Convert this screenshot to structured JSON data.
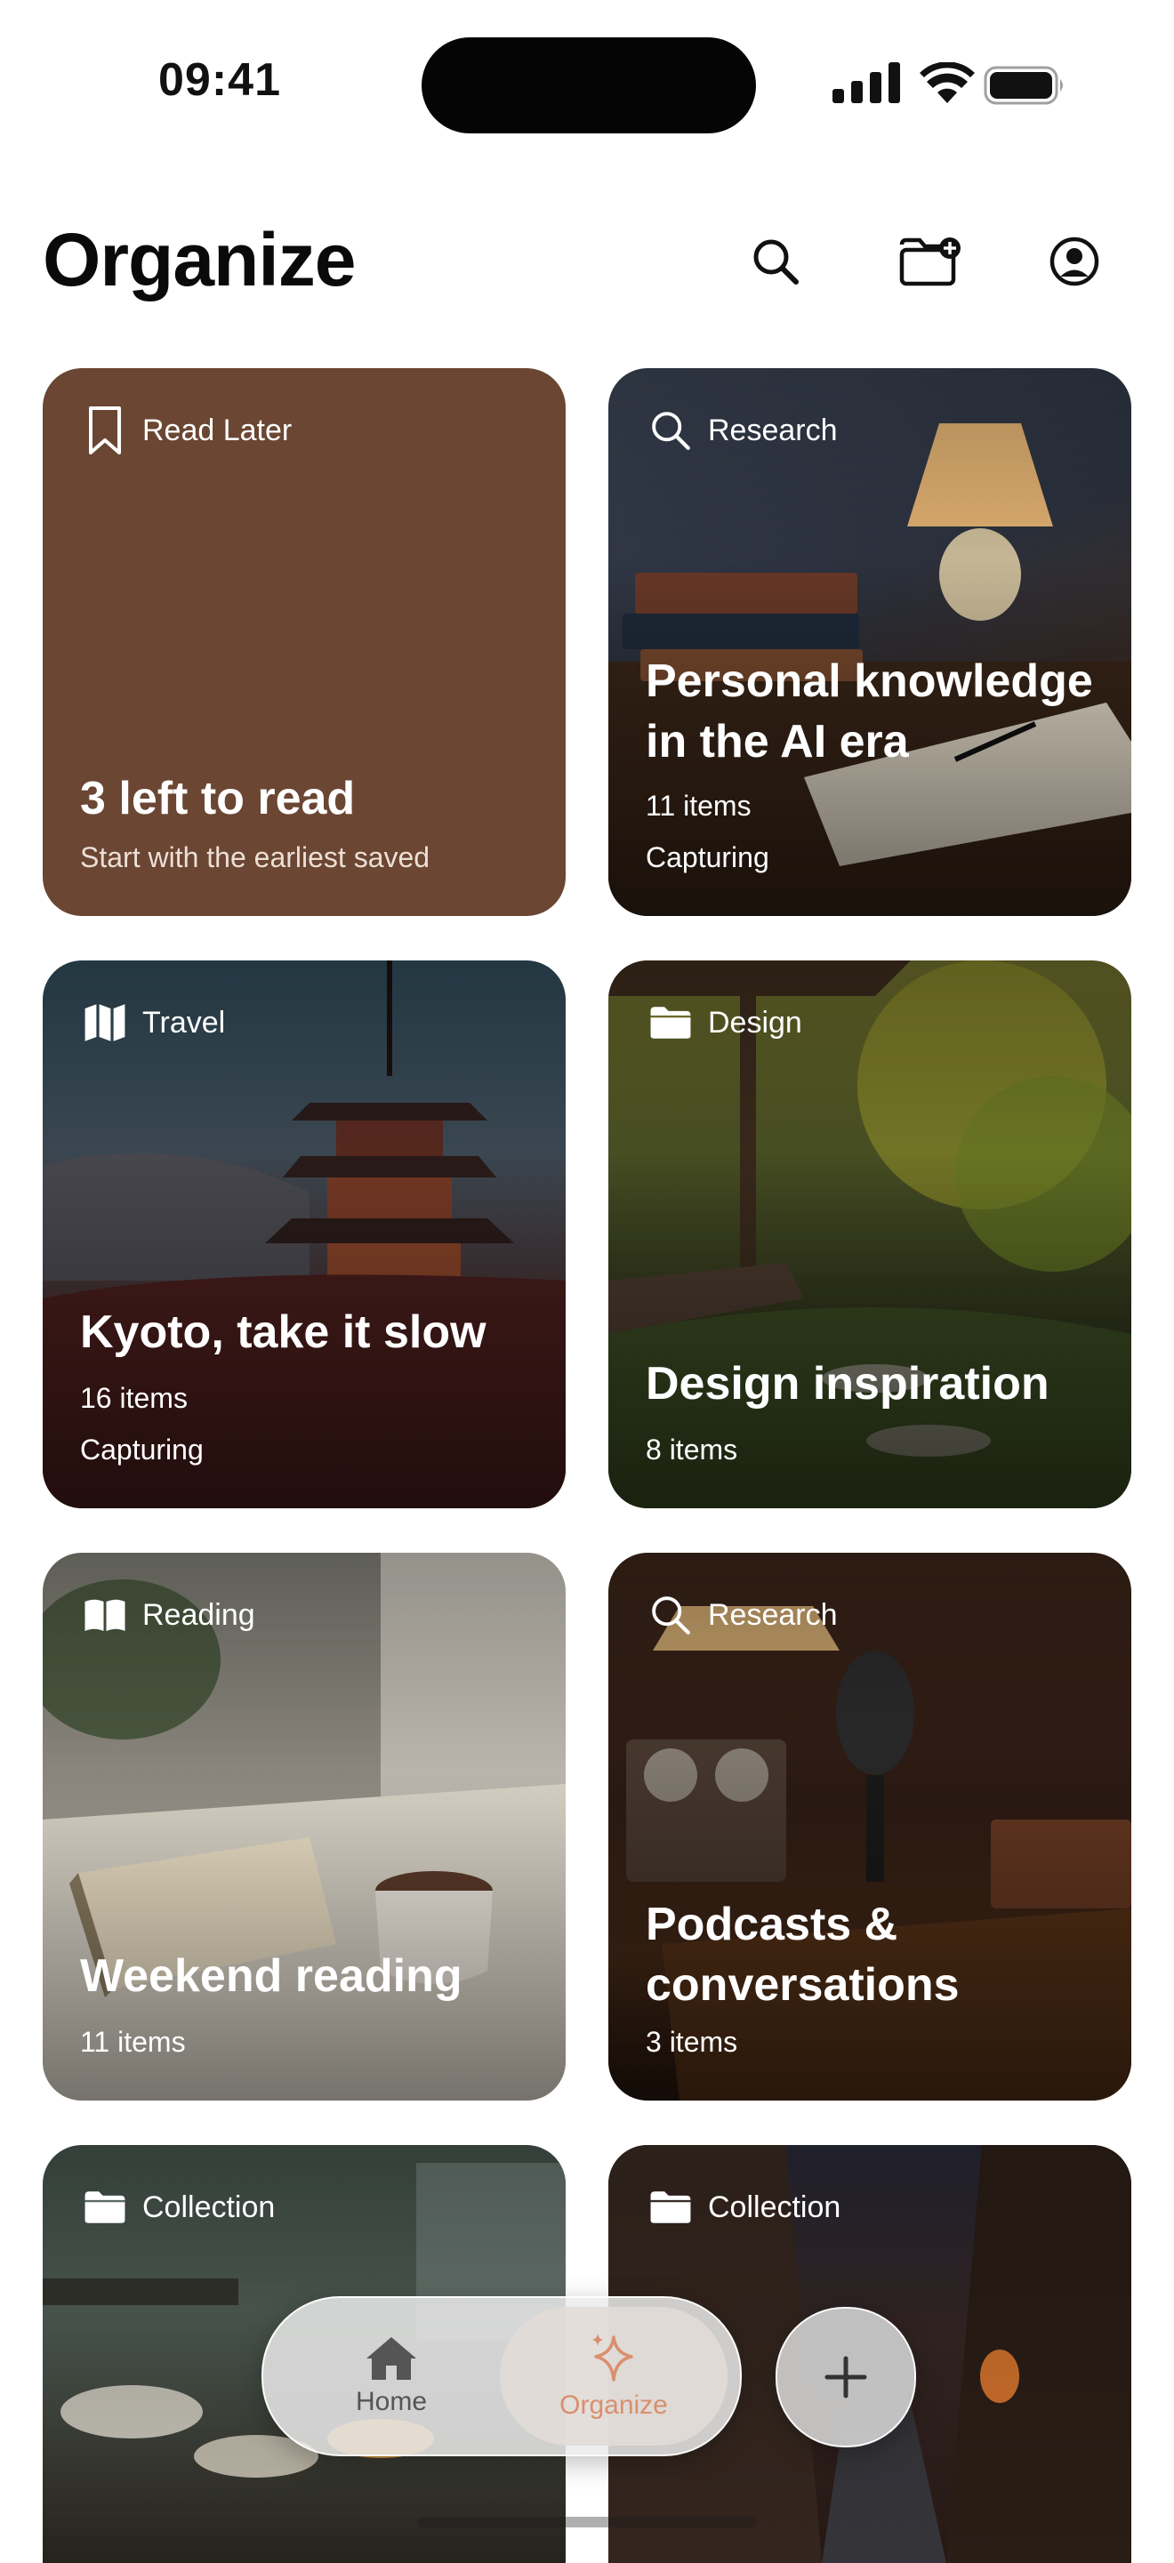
{
  "status": {
    "time": "09:41"
  },
  "header": {
    "title": "Organize"
  },
  "cards": [
    {
      "tag": "Read Later",
      "icon": "bookmark-icon",
      "title": "3 left to read",
      "subtitle": "Start with the earliest saved",
      "color": "#6a4633"
    },
    {
      "tag": "Research",
      "icon": "search-icon",
      "title": "Personal knowledge in the AI era",
      "count": "11 items",
      "status": "Capturing"
    },
    {
      "tag": "Travel",
      "icon": "map-icon",
      "title": "Kyoto, take it slow",
      "count": "16 items",
      "status": "Capturing"
    },
    {
      "tag": "Design",
      "icon": "folder-icon",
      "title": "Design inspiration",
      "count": "8 items"
    },
    {
      "tag": "Reading",
      "icon": "open-book-icon",
      "title": "Weekend reading",
      "count": "11 items"
    },
    {
      "tag": "Research",
      "icon": "search-icon",
      "title": "Podcasts & conversations",
      "count": "3 items"
    },
    {
      "tag": "Collection",
      "icon": "folder-icon"
    },
    {
      "tag": "Collection",
      "icon": "folder-icon"
    }
  ],
  "nav": {
    "home": "Home",
    "organize": "Organize",
    "active_color": "#d98f6f"
  }
}
